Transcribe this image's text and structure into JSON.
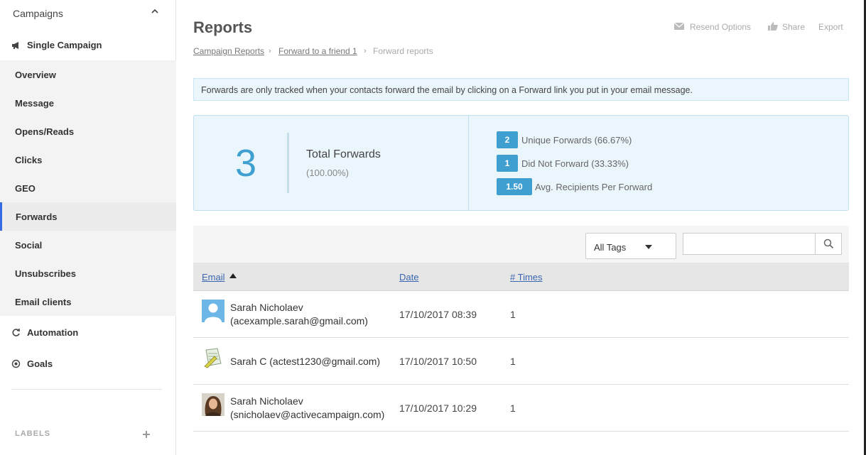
{
  "sidebar": {
    "header": "Campaigns",
    "campaign_label": "Single Campaign",
    "items": [
      {
        "label": "Overview"
      },
      {
        "label": "Message"
      },
      {
        "label": "Opens/Reads"
      },
      {
        "label": "Clicks"
      },
      {
        "label": "GEO"
      },
      {
        "label": "Forwards",
        "active": true
      },
      {
        "label": "Social"
      },
      {
        "label": "Unsubscribes"
      },
      {
        "label": "Email clients"
      }
    ],
    "automation_label": "Automation",
    "goals_label": "Goals",
    "labels_heading": "LABELS"
  },
  "header": {
    "title": "Reports",
    "actions": {
      "resend": "Resend Options",
      "share": "Share",
      "export": "Export"
    }
  },
  "breadcrumb": {
    "items": [
      "Campaign Reports",
      "Forward to a friend 1"
    ],
    "current": "Forward reports"
  },
  "notice": "Forwards are only tracked when your contacts forward the email by clicking on a Forward link you put in your email message.",
  "stats": {
    "total_value": "3",
    "total_label": "Total Forwards",
    "total_pct": "(100.00%)",
    "breakdown": [
      {
        "value": "2",
        "label": "Unique Forwards (66.67%)"
      },
      {
        "value": "1",
        "label": "Did Not Forward (33.33%)"
      },
      {
        "value": "1.50",
        "label": "Avg. Recipients Per Forward"
      }
    ]
  },
  "filters": {
    "tag_select": "All Tags",
    "search_placeholder": ""
  },
  "table": {
    "columns": [
      "Email",
      "Date",
      "# Times"
    ],
    "rows": [
      {
        "name_line1": "Sarah Nicholaev",
        "name_line2": "(acexample.sarah@gmail.com)",
        "date": "17/10/2017 08:39",
        "times": "1",
        "avatar": "default-user-avatar"
      },
      {
        "name_line1": "Sarah C (actest1230@gmail.com)",
        "name_line2": "",
        "date": "17/10/2017 10:50",
        "times": "1",
        "avatar": "document-avatar"
      },
      {
        "name_line1": "Sarah Nicholaev",
        "name_line2": "(snicholaev@activecampaign.com)",
        "date": "17/10/2017 10:29",
        "times": "1",
        "avatar": "photo-avatar"
      }
    ]
  },
  "colors": {
    "accent": "#3f9fd0",
    "active_nav": "#356ae6",
    "panel_bg": "#eaf6fc",
    "link": "#3a66b0"
  }
}
